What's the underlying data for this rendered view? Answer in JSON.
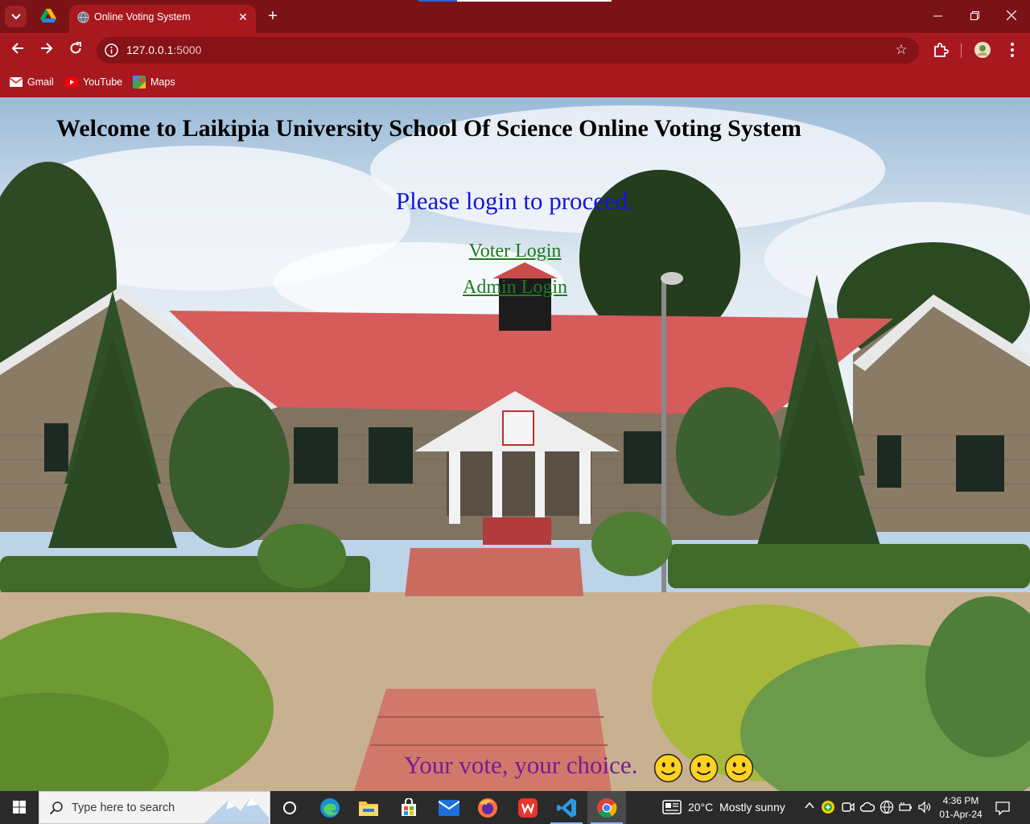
{
  "browser": {
    "tab_title": "Online Voting System",
    "new_tab_symbol": "+",
    "close_symbol": "✕",
    "url_host": "127.0.0.1",
    "url_port": ":5000",
    "bookmarks": [
      {
        "label": "Gmail",
        "icon": "gmail-icon"
      },
      {
        "label": "YouTube",
        "icon": "youtube-icon"
      },
      {
        "label": "Maps",
        "icon": "maps-icon"
      }
    ],
    "theme_color": "#a8191f"
  },
  "page": {
    "heading": "Welcome to Laikipia University School Of Science Online Voting System",
    "prompt": "Please login to proceed.",
    "voter_login": "Voter Login",
    "admin_login": "Admin Login",
    "tagline": "Your vote, your choice.",
    "smileys": [
      "🙂",
      "🙂",
      "🙂"
    ]
  },
  "taskbar": {
    "search_placeholder": "Type here to search",
    "weather": "20°C  Mostly sunny",
    "time": "4:36 PM",
    "date": "01-Apr-24"
  }
}
